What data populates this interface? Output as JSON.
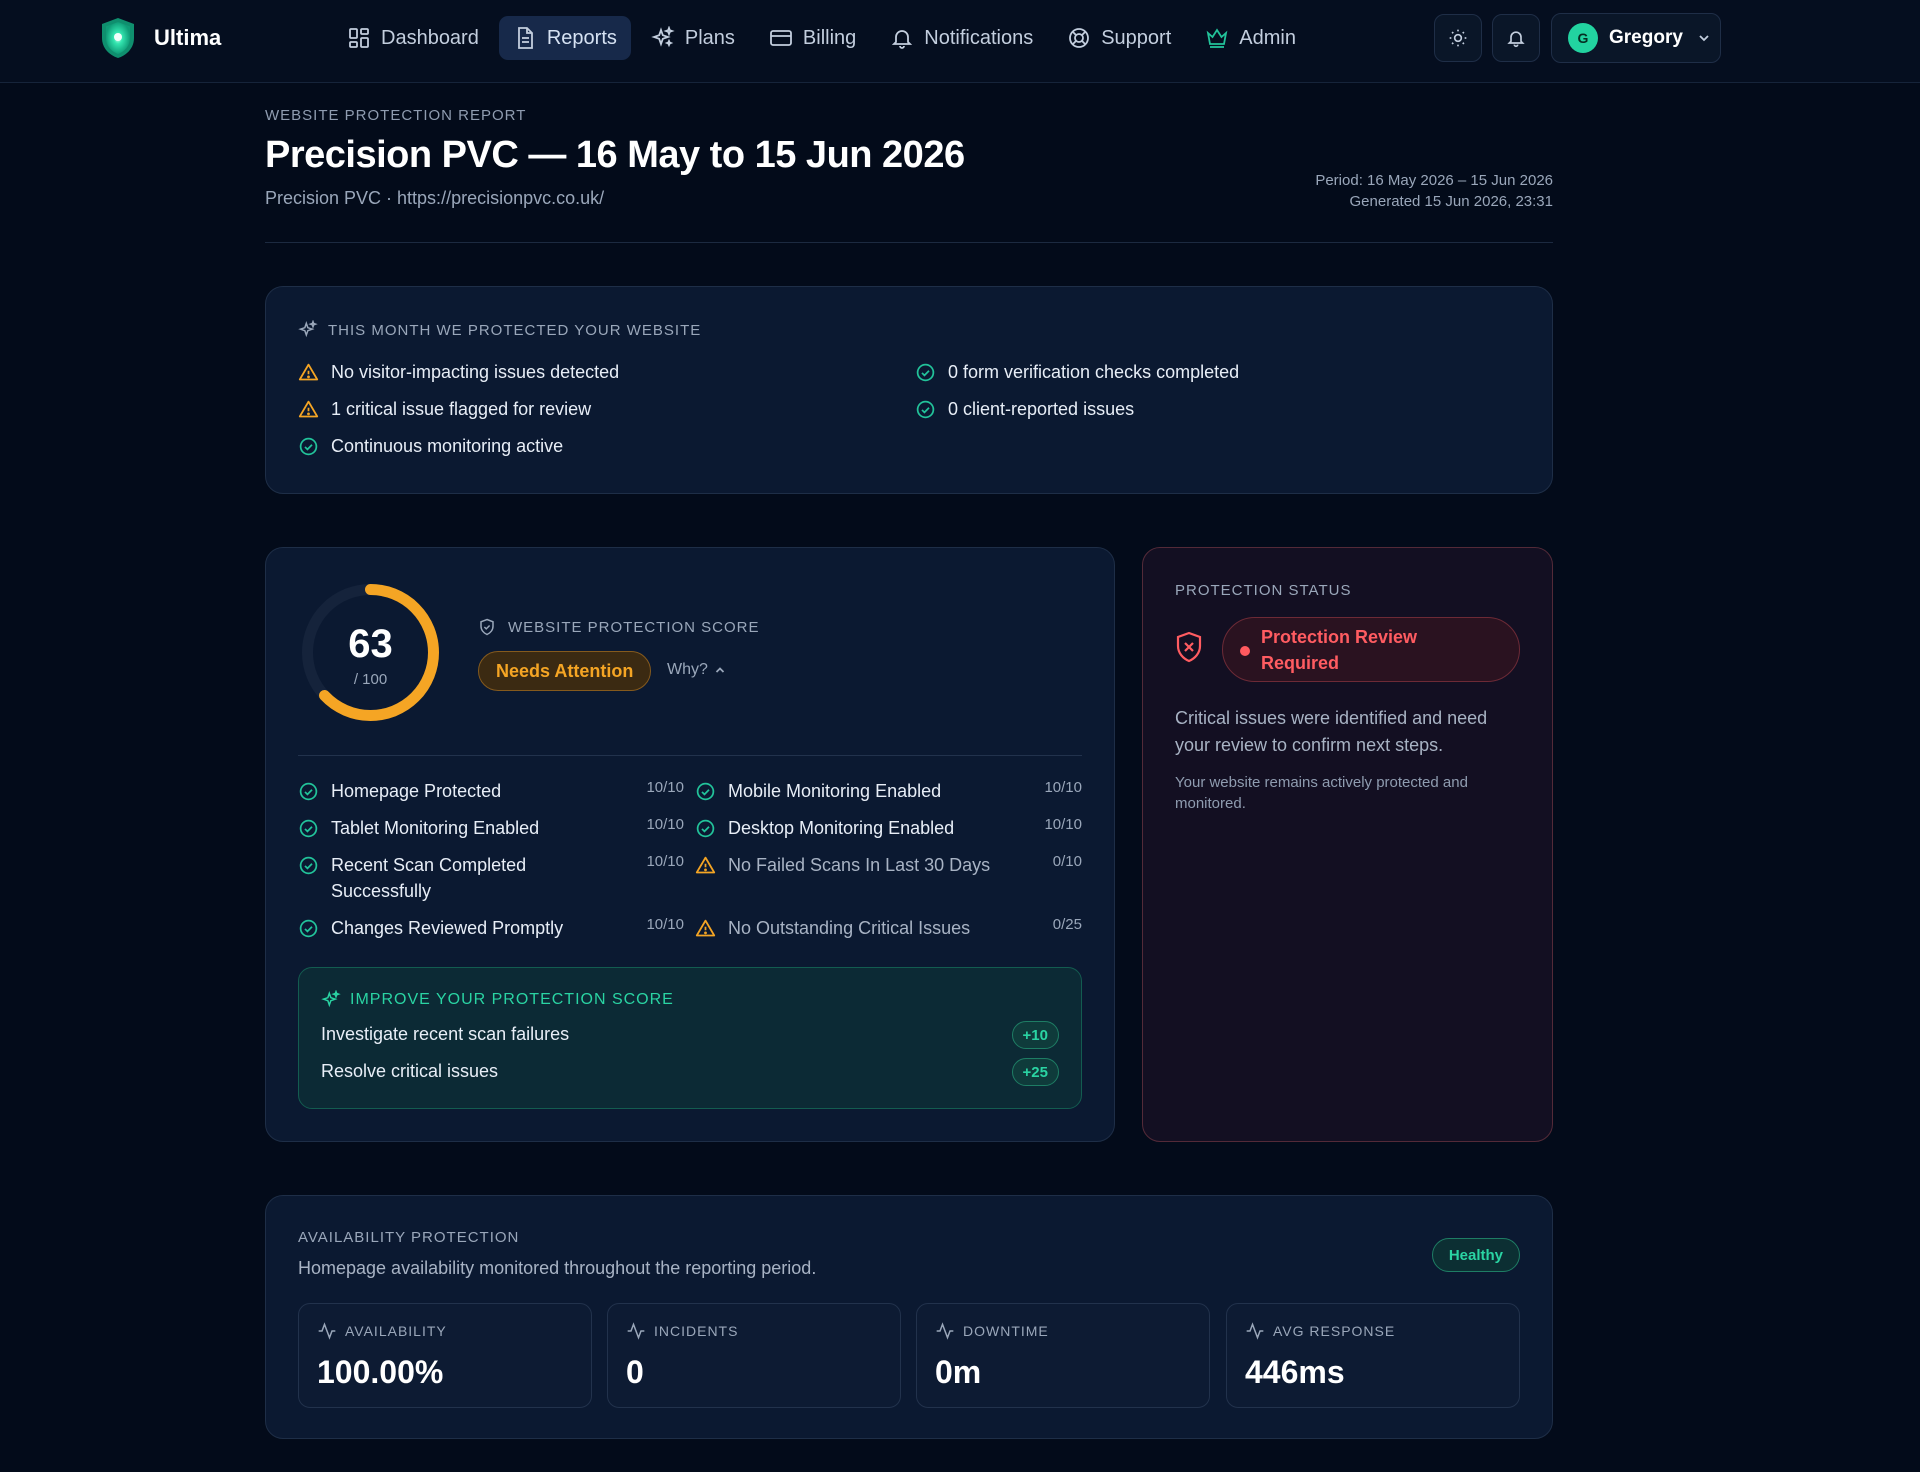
{
  "app": {
    "name": "Ultima"
  },
  "nav": {
    "items": [
      {
        "label": "Dashboard",
        "icon": "grid-icon"
      },
      {
        "label": "Reports",
        "icon": "document-icon",
        "active": true
      },
      {
        "label": "Plans",
        "icon": "sparkles-icon"
      },
      {
        "label": "Billing",
        "icon": "credit-card-icon"
      },
      {
        "label": "Notifications",
        "icon": "bell-icon"
      },
      {
        "label": "Support",
        "icon": "lifebuoy-icon"
      },
      {
        "label": "Admin",
        "icon": "crown-icon"
      }
    ]
  },
  "user": {
    "initial": "G",
    "name": "Gregory"
  },
  "report": {
    "kicker": "WEBSITE PROTECTION REPORT",
    "title": "Precision PVC — 16 May to 15 Jun 2026",
    "subtitle": "Precision PVC · https://precisionpvc.co.uk/",
    "period": "Period: 16 May 2026 – 15 Jun 2026",
    "generated": "Generated 15 Jun 2026, 23:31"
  },
  "protected": {
    "heading": "THIS MONTH WE PROTECTED YOUR WEBSITE",
    "items": [
      {
        "text": "No visitor-impacting issues detected",
        "status": "warn"
      },
      {
        "text": "1 critical issue flagged for review",
        "status": "warn"
      },
      {
        "text": "Continuous monitoring active",
        "status": "ok"
      },
      {
        "text": "0 form verification checks completed",
        "status": "ok"
      },
      {
        "text": "0 client-reported issues",
        "status": "ok"
      }
    ]
  },
  "score": {
    "value": "63",
    "max": "/ 100",
    "fraction": 0.63,
    "label": "WEBSITE PROTECTION SCORE",
    "badge": "Needs Attention",
    "why": "Why?",
    "checks": [
      {
        "label": "Homepage Protected",
        "points": "10/10",
        "status": "ok"
      },
      {
        "label": "Mobile Monitoring Enabled",
        "points": "10/10",
        "status": "ok"
      },
      {
        "label": "Tablet Monitoring Enabled",
        "points": "10/10",
        "status": "ok"
      },
      {
        "label": "Desktop Monitoring Enabled",
        "points": "10/10",
        "status": "ok"
      },
      {
        "label": "Recent Scan Completed Successfully",
        "points": "10/10",
        "status": "ok"
      },
      {
        "label": "No Failed Scans In Last 30 Days",
        "points": "0/10",
        "status": "warn"
      },
      {
        "label": "Changes Reviewed Promptly",
        "points": "10/10",
        "status": "ok"
      },
      {
        "label": "No Outstanding Critical Issues",
        "points": "0/25",
        "status": "warn"
      }
    ],
    "improve": {
      "heading": "IMPROVE YOUR PROTECTION SCORE",
      "items": [
        {
          "label": "Investigate recent scan failures",
          "points": "+10"
        },
        {
          "label": "Resolve critical issues",
          "points": "+25"
        }
      ]
    }
  },
  "status": {
    "label": "PROTECTION STATUS",
    "pill": "Protection Review Required",
    "description": "Critical issues were identified and need your review to confirm next steps.",
    "note": "Your website remains actively protected and monitored."
  },
  "availability": {
    "label": "AVAILABILITY PROTECTION",
    "description": "Homepage availability monitored throughout the reporting period.",
    "badge": "Healthy",
    "metrics": [
      {
        "label": "AVAILABILITY",
        "value": "100.00%"
      },
      {
        "label": "INCIDENTS",
        "value": "0"
      },
      {
        "label": "DOWNTIME",
        "value": "0m"
      },
      {
        "label": "AVG RESPONSE",
        "value": "446ms"
      }
    ]
  },
  "colors": {
    "accent": "#22c39a",
    "warning": "#f5a524",
    "danger": "#ff5c61",
    "background": "#030b1a",
    "card": "#0b1931"
  }
}
